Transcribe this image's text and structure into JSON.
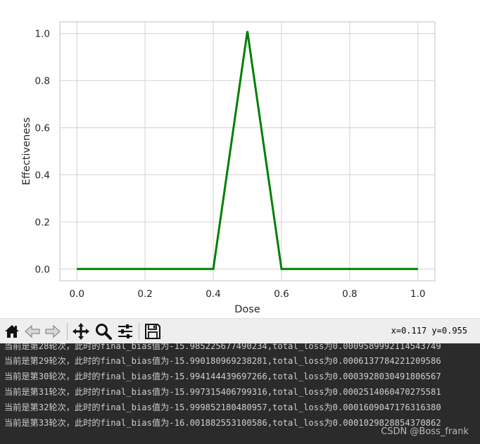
{
  "chart_data": {
    "type": "line",
    "xlabel": "Dose",
    "ylabel": "Effectiveness",
    "xlim": [
      -0.05,
      1.05
    ],
    "ylim": [
      -0.05,
      1.05
    ],
    "xticks": [
      0.0,
      0.2,
      0.4,
      0.6,
      0.8,
      1.0
    ],
    "xtick_labels": [
      "0.0",
      "0.2",
      "0.4",
      "0.6",
      "0.8",
      "1.0"
    ],
    "yticks": [
      0.0,
      0.2,
      0.4,
      0.6,
      0.8,
      1.0
    ],
    "ytick_labels": [
      "0.0",
      "0.2",
      "0.4",
      "0.6",
      "0.8",
      "1.0"
    ],
    "grid": true,
    "series": [
      {
        "color": "#008000",
        "x": [
          0.0,
          0.4,
          0.5,
          0.6,
          1.0
        ],
        "y": [
          0.0,
          0.0,
          1.01,
          0.0,
          0.0
        ]
      }
    ]
  },
  "toolbar": {
    "buttons": [
      {
        "name": "home-button",
        "icon": "home-icon"
      },
      {
        "name": "back-button",
        "icon": "arrow-left-icon"
      },
      {
        "name": "forward-button",
        "icon": "arrow-right-icon"
      },
      {
        "name": "pan-button",
        "icon": "move-icon"
      },
      {
        "name": "zoom-button",
        "icon": "magnifier-icon"
      },
      {
        "name": "configure-subplots-button",
        "icon": "sliders-icon"
      },
      {
        "name": "save-button",
        "icon": "floppy-disk-icon"
      }
    ],
    "coords": "x=0.117 y=0.955"
  },
  "console": {
    "lines": [
      "当前是第28轮次，此时的final_bias值为-15.985225677490234,total_loss为0.0009589992114543749",
      "当前是第29轮次，此时的final_bias值为-15.990180969238281,total_loss为0.0006137784221209586",
      "当前是第30轮次，此时的final_bias值为-15.994144439697266,total_loss为0.0003928030491806567",
      "当前是第31轮次，此时的final_bias值为-15.997315406799316,total_loss为0.0002514060470275581",
      "当前是第32轮次，此时的final_bias值为-15.999852180480957,total_loss为0.0001609047176316380",
      "当前是第33轮次，此时的final_bias值为-16.001882553100586,total_loss为0.0001029828854370862"
    ],
    "watermark": "CSDN @Boss_frank"
  }
}
